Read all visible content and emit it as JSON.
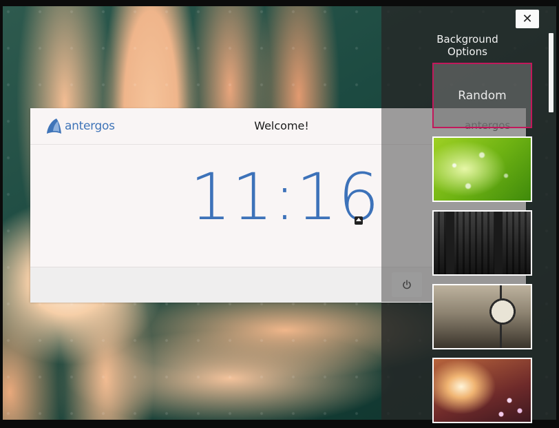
{
  "side_panel": {
    "close_label": "✕",
    "title": "Background Options",
    "random_label": "Random",
    "thumbnails": [
      {
        "name": "green-bokeh"
      },
      {
        "name": "black-and-white-room"
      },
      {
        "name": "street-clock"
      },
      {
        "name": "cherry-blossom-sunset"
      }
    ]
  },
  "login": {
    "brand": "antergos",
    "welcome": "Welcome!",
    "panel_brand": "antergos",
    "clock": "11:16"
  },
  "colors": {
    "accent_blue": "#3d72b9",
    "selected_border": "#c2185b"
  },
  "icons": {
    "logo": "antergos-logo-icon",
    "power": "power-icon",
    "clock_toggle": "chevron-up-icon",
    "close": "close-icon"
  }
}
